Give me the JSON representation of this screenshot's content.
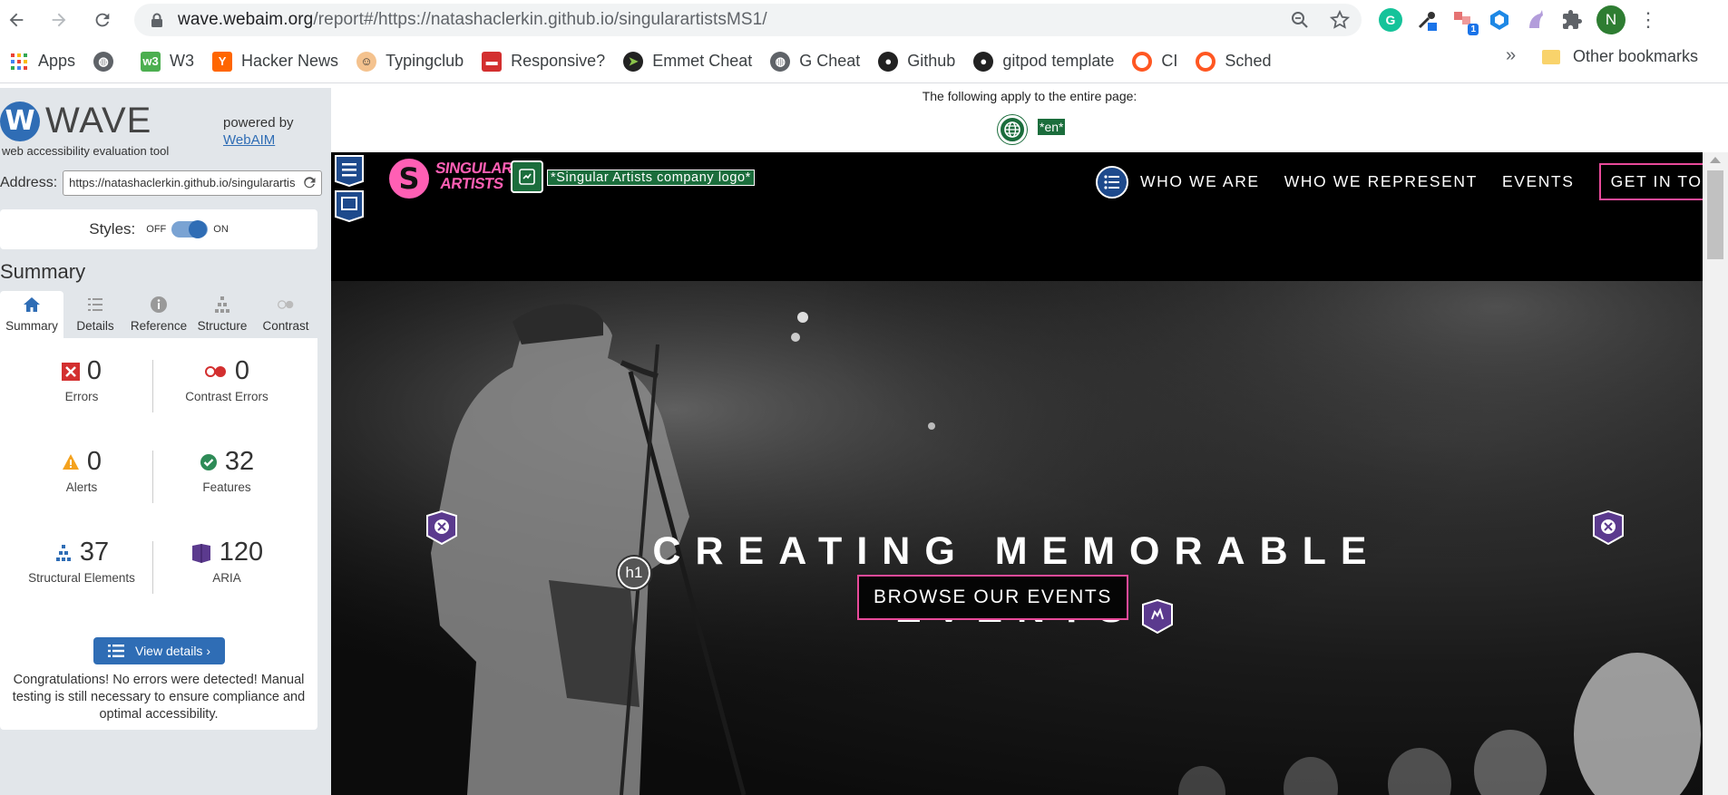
{
  "browser": {
    "url_host": "wave.webaim.org",
    "url_path": "/report#/https://natashaclerkin.github.io/singularartistsMS1/",
    "profile_initial": "N",
    "extension_badge": "1",
    "bookmarks": [
      {
        "label": "Apps",
        "icon": "apps-grid-icon",
        "color": "#ea4335"
      },
      {
        "label": "",
        "icon": "globe-icon",
        "color": "#5f6368"
      },
      {
        "label": "W3",
        "icon": "w3schools-icon",
        "color": "#4caf50"
      },
      {
        "label": "Hacker News",
        "icon": "hacker-news-icon",
        "color": "#ff6600"
      },
      {
        "label": "Typingclub",
        "icon": "typingclub-icon",
        "color": "#333333"
      },
      {
        "label": "Responsive?",
        "icon": "responsive-icon",
        "color": "#d32f2f"
      },
      {
        "label": "Emmet Cheat",
        "icon": "emmet-icon",
        "color": "#222222"
      },
      {
        "label": "G Cheat",
        "icon": "globe-icon",
        "color": "#5f6368"
      },
      {
        "label": "Github",
        "icon": "github-icon",
        "color": "#222222"
      },
      {
        "label": "gitpod template",
        "icon": "github-icon",
        "color": "#222222"
      },
      {
        "label": "CI",
        "icon": "ci-icon",
        "color": "#ff5722"
      },
      {
        "label": "Sched",
        "icon": "sched-icon",
        "color": "#ff5722"
      }
    ],
    "more_label": "»",
    "other_bookmarks": "Other bookmarks"
  },
  "wave": {
    "logo_text": "WAVE",
    "subtitle": "web accessibility evaluation tool",
    "powered_by": "powered by",
    "webaim_link": "WebAIM",
    "address_label": "Address:",
    "address_value": "https://natashaclerkin.github.io/singularartis",
    "styles_label": "Styles:",
    "styles_off": "OFF",
    "styles_on": "ON",
    "summary_heading": "Summary",
    "tabs": [
      {
        "label": "Summary",
        "icon": "home-icon"
      },
      {
        "label": "Details",
        "icon": "list-icon"
      },
      {
        "label": "Reference",
        "icon": "info-icon"
      },
      {
        "label": "Structure",
        "icon": "hierarchy-icon"
      },
      {
        "label": "Contrast",
        "icon": "contrast-icon"
      }
    ],
    "stats": {
      "errors": {
        "value": "0",
        "label": "Errors",
        "color": "#d32f2f"
      },
      "contrast_errors": {
        "value": "0",
        "label": "Contrast Errors",
        "color": "#d32f2f"
      },
      "alerts": {
        "value": "0",
        "label": "Alerts",
        "color": "#f4a21e"
      },
      "features": {
        "value": "32",
        "label": "Features",
        "color": "#2e8b57"
      },
      "structural": {
        "value": "37",
        "label": "Structural Elements",
        "color": "#2f6db5"
      },
      "aria": {
        "value": "120",
        "label": "ARIA",
        "color": "#5b3a8e"
      }
    },
    "view_details": "View details ›",
    "congrats": "Congratulations! No errors were detected! Manual testing is still necessary to ensure compliance and optimal accessibility."
  },
  "preview": {
    "applies_text": "The following apply to the entire page:",
    "lang_tag": "*en*",
    "logo_text_line1": "SINGULAR",
    "logo_text_line2": "ARTISTS",
    "logo_alt": "*Singular Artists company logo*",
    "nav": [
      "WHO WE ARE",
      "WHO WE REPRESENT",
      "EVENTS"
    ],
    "nav_cta": "GET IN TOUCH",
    "hero_line1": "CREATING MEMORABLE",
    "hero_line2": "EVENTS",
    "hero_button": "BROWSE OUR EVENTS",
    "h1_tag": "h1",
    "accent_color": "#e84a9a",
    "wave_green": "#1b6d3c"
  }
}
